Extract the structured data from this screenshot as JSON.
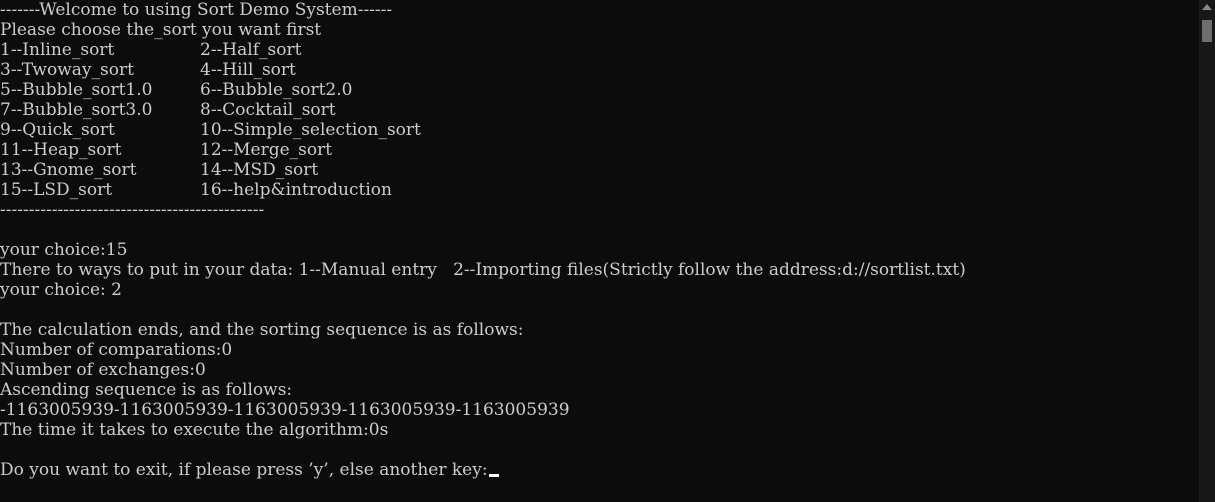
{
  "console": {
    "header": "-------Welcome to using Sort Demo System------",
    "prompt": "Please choose the_sort you want first",
    "menu": [
      {
        "left": "1--Inline_sort",
        "right": "2--Half_sort"
      },
      {
        "left": "3--Twoway_sort",
        "right": "4--Hill_sort"
      },
      {
        "left": "5--Bubble_sort1.0",
        "right": "6--Bubble_sort2.0"
      },
      {
        "left": "7--Bubble_sort3.0",
        "right": "8--Cocktail_sort"
      },
      {
        "left": "9--Quick_sort",
        "right": "10--Simple_selection_sort"
      },
      {
        "left": "11--Heap_sort",
        "right": "12--Merge_sort"
      },
      {
        "left": "13--Gnome_sort",
        "right": "14--MSD_sort"
      },
      {
        "left": "15--LSD_sort",
        "right": "16--help&introduction"
      }
    ],
    "divider": "----------------------------------------------",
    "choice1": "your choice:15",
    "ways": "There to ways to put in your data: 1--Manual entry   2--Importing files(Strictly follow the address:d://sortlist.txt)",
    "choice2": "your choice: 2",
    "calc_ends": "The calculation ends, and the sorting sequence is as follows:",
    "comparisons": "Number of comparations:0",
    "exchanges": "Number of exchanges:0",
    "ascending": "Ascending sequence is as follows:",
    "sequence": "-1163005939-1163005939-1163005939-1163005939-1163005939",
    "time": "The time it takes to execute the algorithm:0s",
    "exit_prompt": "Do you want to exit, if please press ’y’, else another key:"
  }
}
